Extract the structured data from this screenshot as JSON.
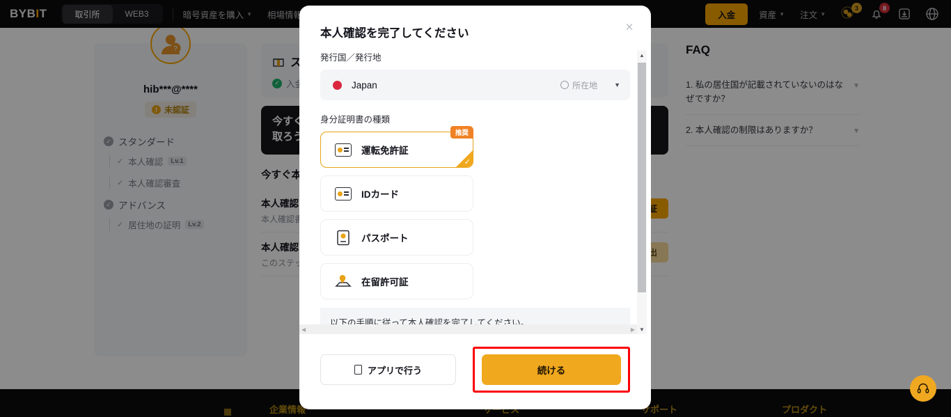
{
  "topnav": {
    "logo": "BYBIT",
    "segments": [
      {
        "label": "取引所",
        "active": true
      },
      {
        "label": "WEB3",
        "active": false
      }
    ],
    "links": [
      {
        "label": "暗号資産を購入",
        "caret": true
      },
      {
        "label": "相場情報",
        "caret": true
      }
    ],
    "deposit_label": "入金",
    "right_links": [
      {
        "label": "資産",
        "caret": true
      },
      {
        "label": "注文",
        "caret": true
      }
    ],
    "coins_badge": "3",
    "bell_badge": "8",
    "icons": [
      "coins-icon",
      "bell-icon",
      "download-icon",
      "globe-icon"
    ]
  },
  "sidebar": {
    "username": "hib***@****",
    "status_badge": "未認証",
    "status_icon": "!",
    "groups": [
      {
        "title": "スタンダード",
        "items": [
          {
            "label": "本人確認",
            "level": "Lv.1"
          },
          {
            "label": "本人確認審査",
            "level": ""
          }
        ]
      },
      {
        "title": "アドバンス",
        "items": [
          {
            "label": "居住地の証明",
            "level": "Lv.2"
          }
        ]
      }
    ]
  },
  "main": {
    "gift_title": "ス",
    "gift_sub": "入金",
    "banner_line1": "今すぐ",
    "banner_line2": "取ろう",
    "section_title": "今すぐ本",
    "steps": [
      {
        "title": "本人確認",
        "desc": "本人確認書",
        "button": "証"
      },
      {
        "title": "本人確認",
        "desc": "このステップ",
        "button": "出"
      }
    ]
  },
  "faq": {
    "title": "FAQ",
    "items": [
      {
        "text": "1. 私の居住国が記載されていないのはなぜですか？"
      },
      {
        "text": "2. 本人確認の制限はありますか？"
      }
    ]
  },
  "modal": {
    "title": "本人確認を完了してください",
    "close_icon": "×",
    "country_label": "発行国／発行地",
    "country_value": "Japan",
    "country_hint": "所在地",
    "id_type_label": "身分証明書の種類",
    "id_options": [
      {
        "label": "運転免許証",
        "icon": "drivers-license-icon",
        "recommended": true,
        "badge": "推奨",
        "selected": true
      },
      {
        "label": "IDカード",
        "icon": "id-card-icon",
        "recommended": false,
        "badge": "",
        "selected": false
      },
      {
        "label": "パスポート",
        "icon": "passport-icon",
        "recommended": false,
        "badge": "",
        "selected": false
      },
      {
        "label": "在留許可証",
        "icon": "residence-permit-icon",
        "recommended": false,
        "badge": "",
        "selected": false
      }
    ],
    "note": "以下の手順に従って本人確認を完了してください。",
    "app_button": "アプリで行う",
    "continue_button": "続ける"
  },
  "footer": {
    "columns": [
      "企業情報",
      "サービス",
      "サポート",
      "プロダクト"
    ]
  },
  "colors": {
    "accent": "#f7a600",
    "continue": "#f0a81e",
    "highlight_border": "#fb0007",
    "badge_red": "#d6313b",
    "badge_gold": "#d9a021",
    "flag_red": "#d9273e"
  }
}
